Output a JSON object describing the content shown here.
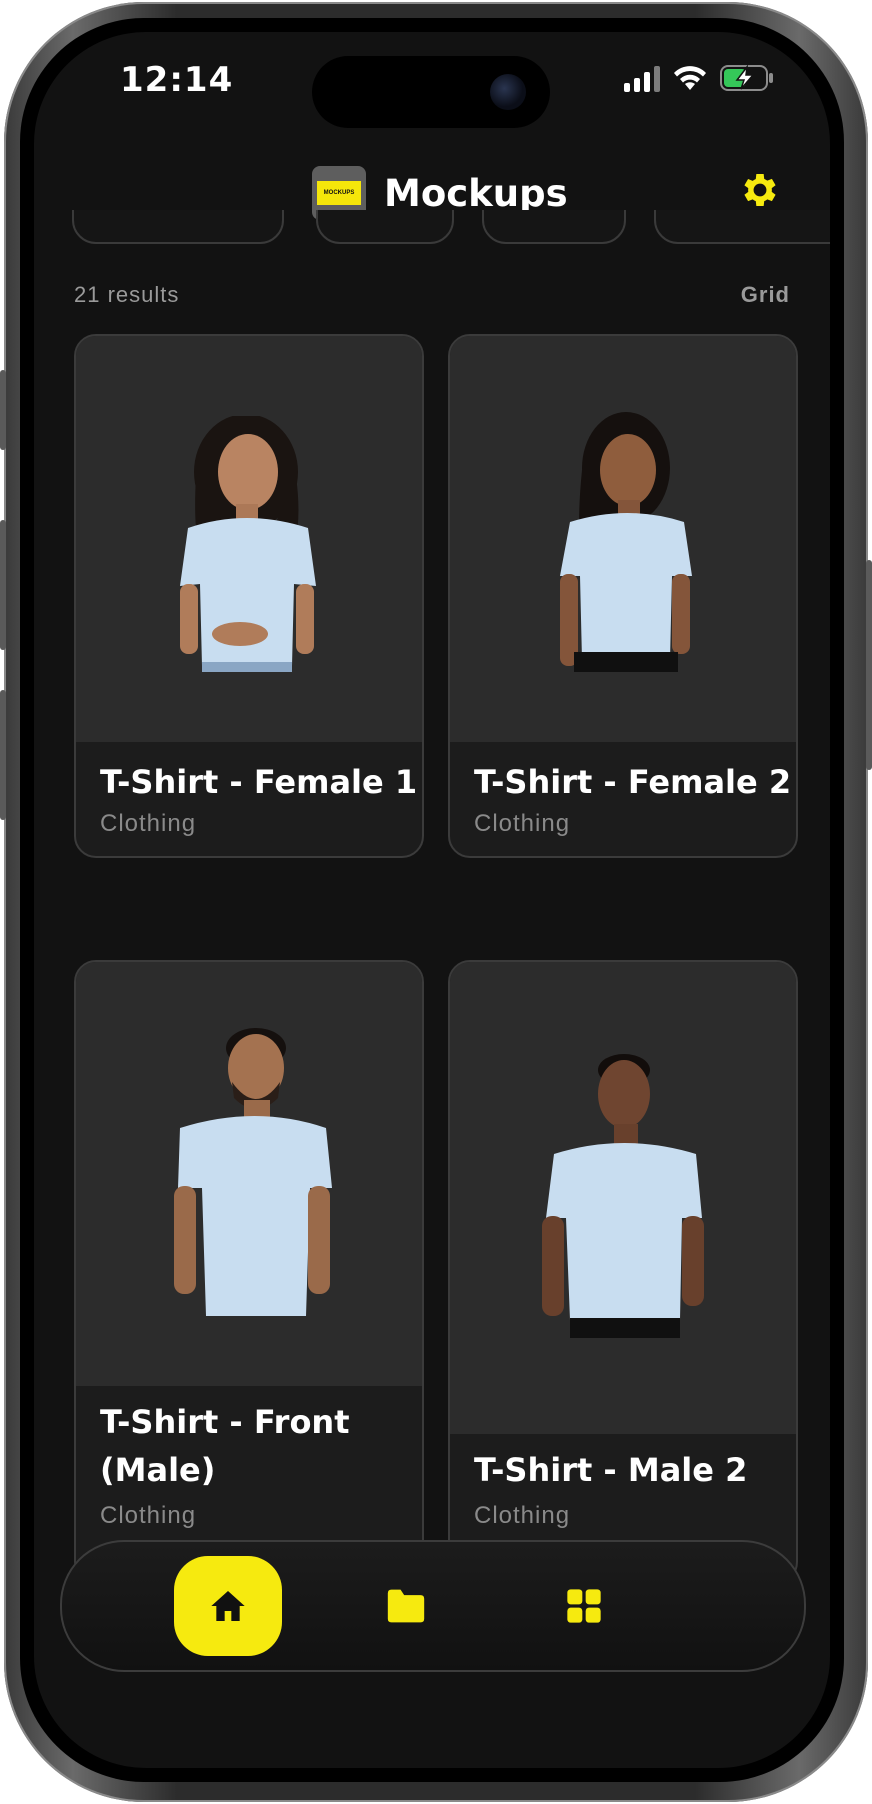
{
  "status_bar": {
    "time": "12:14"
  },
  "header": {
    "title": "Mockups",
    "logo_text": "MOCKUPS"
  },
  "results": {
    "count_label": "21 results",
    "view_label": "Grid"
  },
  "cards": [
    {
      "name": "T-Shirt - Female 1",
      "category": "Clothing"
    },
    {
      "name": "T-Shirt - Female 2",
      "category": "Clothing"
    },
    {
      "name": "T-Shirt - Front (Male)",
      "category": "Clothing"
    },
    {
      "name": "T-Shirt - Male 2",
      "category": "Clothing"
    }
  ],
  "nav": {
    "items": [
      {
        "icon": "home-icon",
        "active": true
      },
      {
        "icon": "folder-icon",
        "active": false
      },
      {
        "icon": "grid-icon",
        "active": false
      }
    ]
  },
  "colors": {
    "accent": "#F6EA0F",
    "background": "#121212",
    "card": "#2C2C2C",
    "shirt": "#C8DDF0"
  }
}
